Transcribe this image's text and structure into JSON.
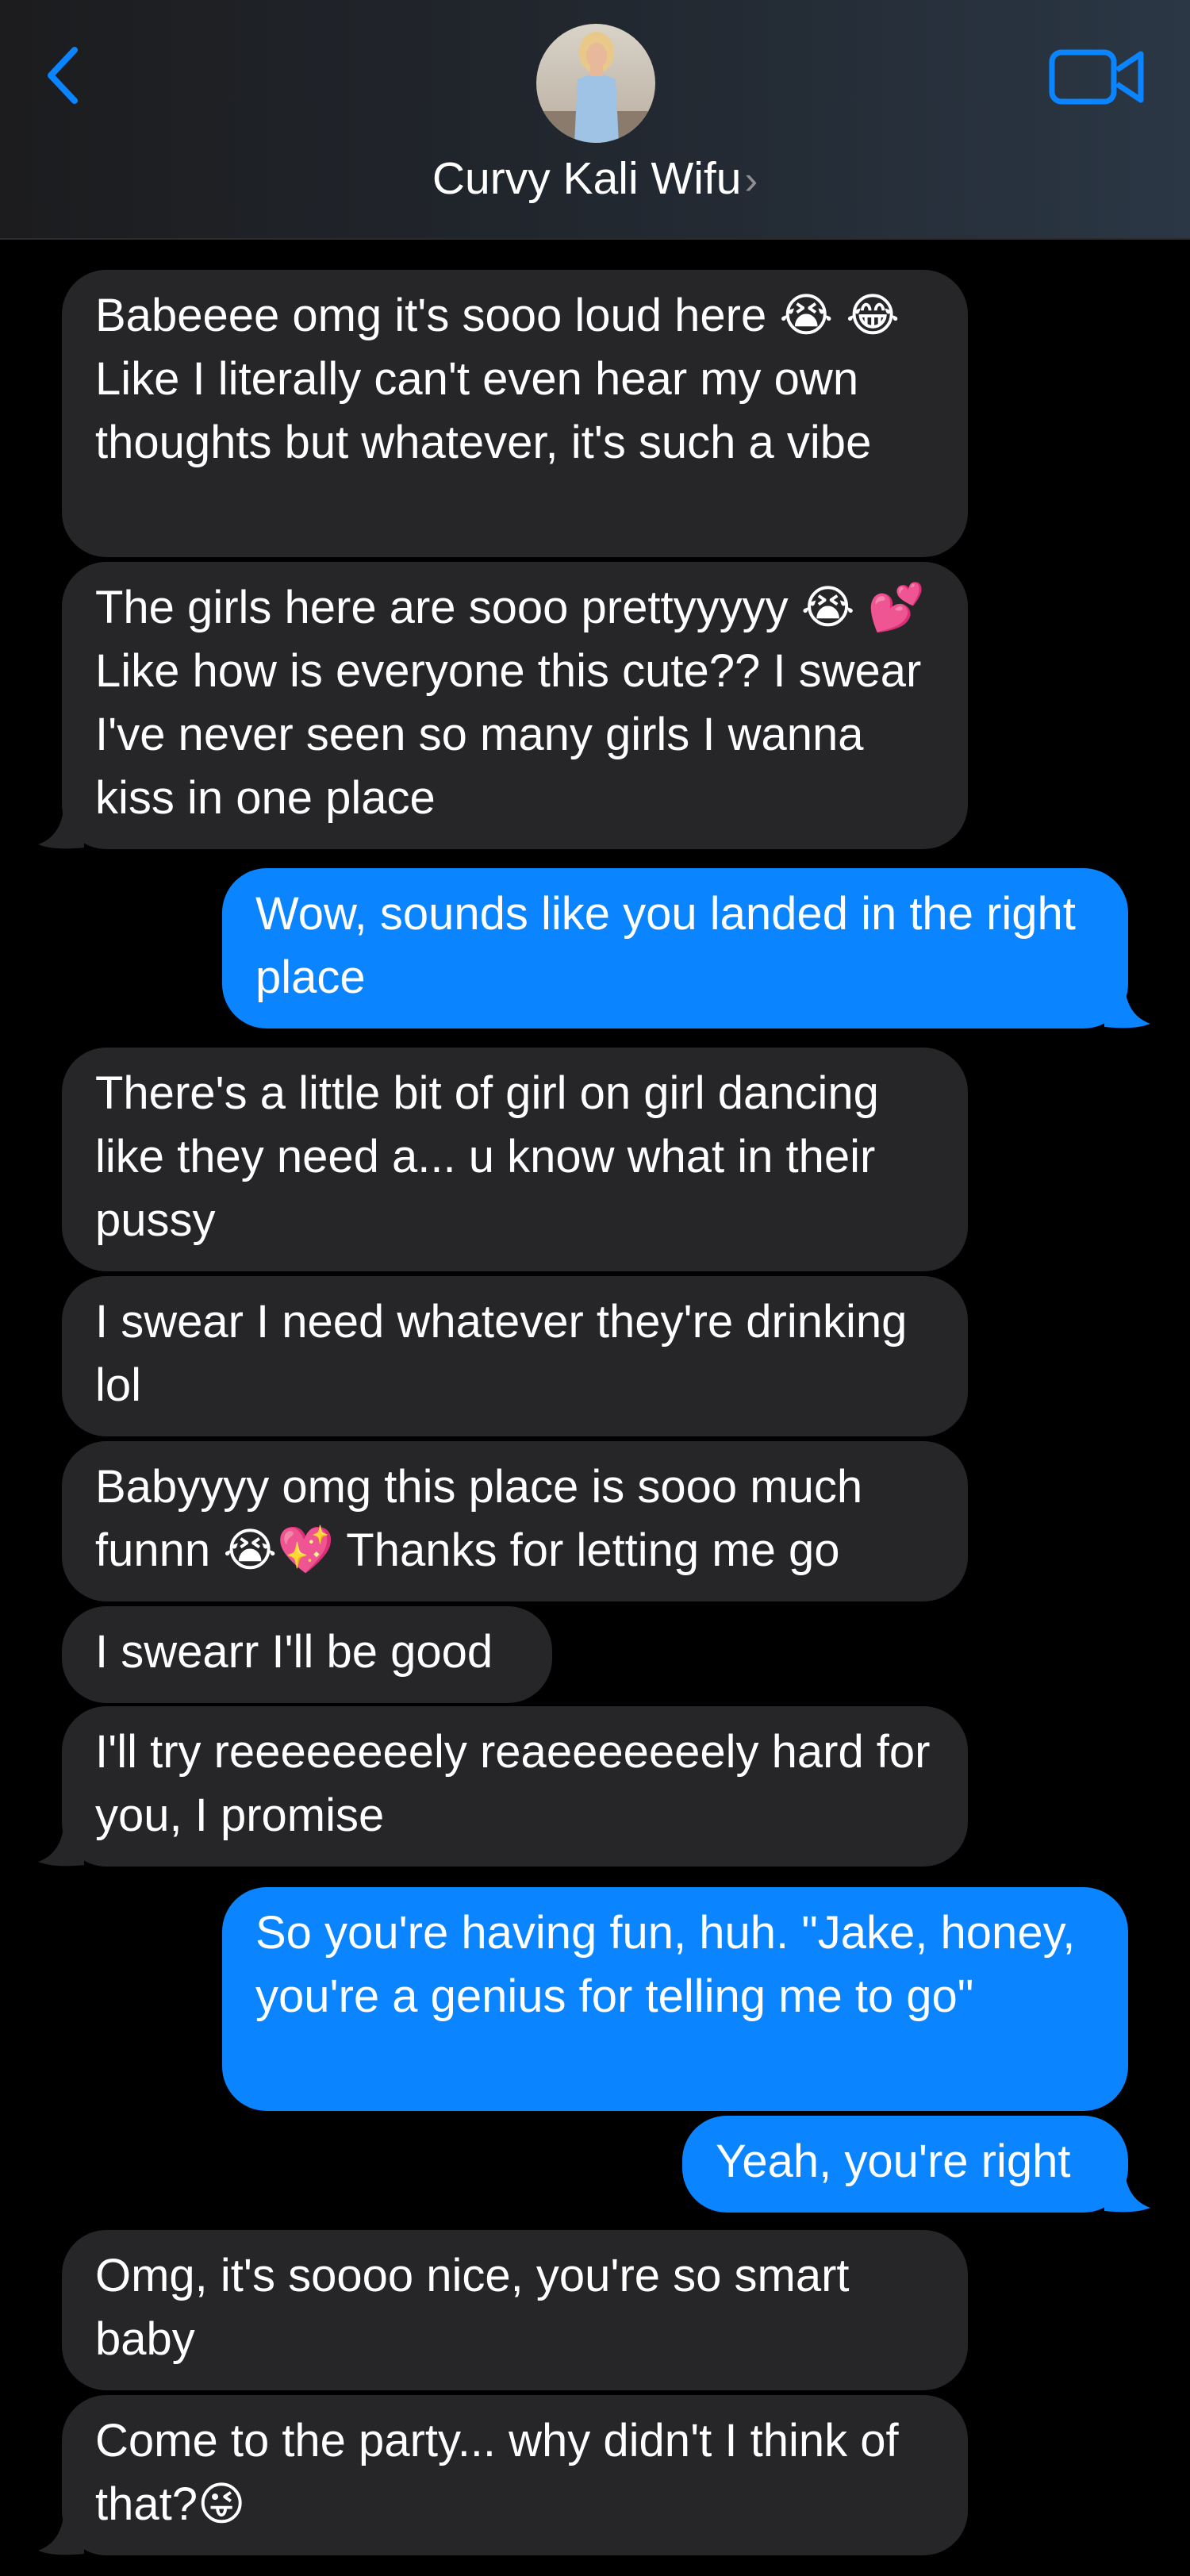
{
  "header": {
    "contact_name": "Curvy Kali Wifu",
    "chevron": "›",
    "icons": {
      "back": "chevron-left-icon",
      "video": "video-camera-icon"
    },
    "accent_color": "#0a84ff"
  },
  "messages": [
    {
      "direction": "incoming",
      "text": "Babeeee omg it's sooo loud here 😭 😂 Like I literally can't even hear my own thoughts but whatever, it's such a vibe"
    },
    {
      "direction": "incoming",
      "text": "The girls here are sooo prettyyyyy 😭 💕 Like how is everyone this cute?? I swear I've never seen so many girls I wanna kiss in one place"
    },
    {
      "direction": "outgoing",
      "text": "Wow, sounds like you landed in the right place"
    },
    {
      "direction": "incoming",
      "text": "There's a little bit of girl on girl dancing like they need a... u know what in their pussy"
    },
    {
      "direction": "incoming",
      "text": "I swear I need whatever they're drinking lol"
    },
    {
      "direction": "incoming",
      "text": "Babyyyy omg this place is sooo much funnn 😭💖 Thanks for letting me go"
    },
    {
      "direction": "incoming",
      "text": "I swearr I'll be good"
    },
    {
      "direction": "incoming",
      "text": "I'll try reeeeeeeely reaeeeeeeely hard for you, I promise"
    },
    {
      "direction": "outgoing",
      "text": "So you're having fun, huh. \"Jake, honey, you're a genius for telling me to go\""
    },
    {
      "direction": "outgoing",
      "text": "Yeah, you're right"
    },
    {
      "direction": "incoming",
      "text": "Omg, it's soooo nice, you're so smart baby"
    },
    {
      "direction": "incoming",
      "text": "Come to the party... why didn't I think of that?😜"
    }
  ],
  "colors": {
    "incoming_bubble": "#262629",
    "outgoing_bubble": "#0a84ff",
    "background": "#000000"
  }
}
